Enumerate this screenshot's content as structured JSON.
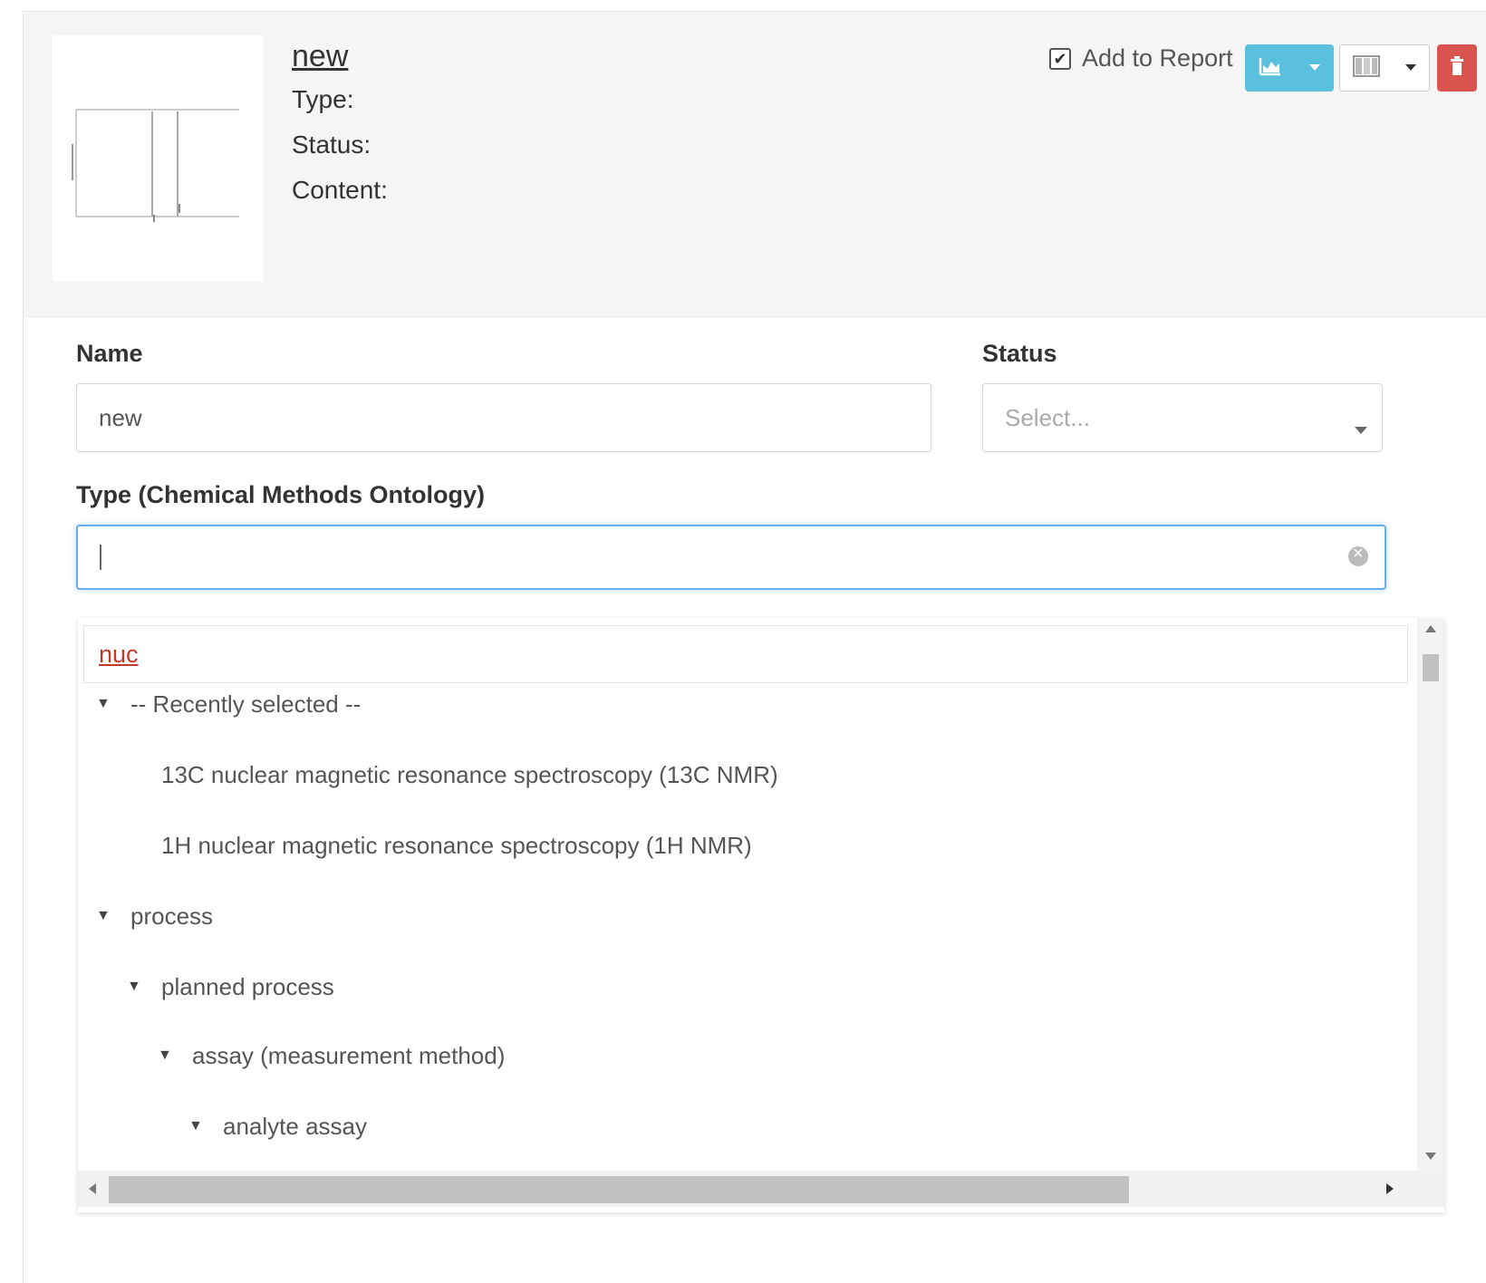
{
  "header": {
    "title": "new",
    "type_label": "Type:",
    "status_label": "Status:",
    "content_label": "Content:",
    "add_to_report_label": "Add to Report",
    "add_to_report_checked": true
  },
  "form": {
    "name_label": "Name",
    "name_value": "new",
    "status_label": "Status",
    "status_placeholder": "Select...",
    "type_label": "Type (Chemical Methods Ontology)",
    "type_value": ""
  },
  "dropdown": {
    "search_text": "nuc",
    "items": [
      {
        "label": "-- Recently selected --",
        "expanded": true,
        "level": 0
      },
      {
        "label": "13C nuclear magnetic resonance spectroscopy (13C NMR)",
        "level": 1
      },
      {
        "label": "1H nuclear magnetic resonance spectroscopy (1H NMR)",
        "level": 1
      },
      {
        "label": "process",
        "expanded": true,
        "level": 0
      },
      {
        "label": "planned process",
        "expanded": true,
        "level": 1
      },
      {
        "label": "assay (measurement method)",
        "expanded": true,
        "level": 2
      },
      {
        "label": "analyte assay",
        "expanded": true,
        "level": 3
      }
    ]
  },
  "colors": {
    "info_button": "#5bc0de",
    "danger_button": "#d9534f",
    "focus_border": "#66afe9",
    "search_text": "#c0392b"
  }
}
